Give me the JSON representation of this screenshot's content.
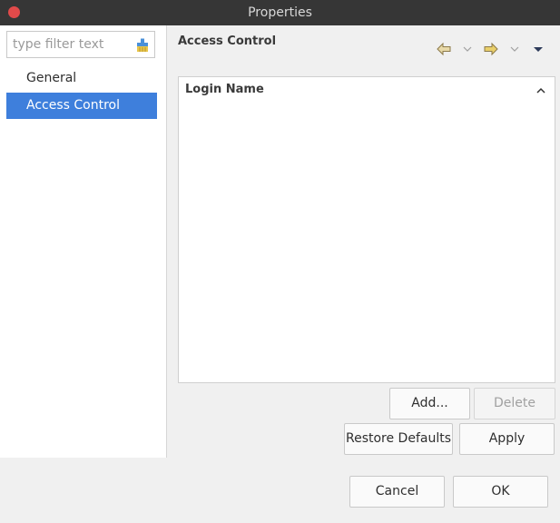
{
  "window": {
    "title": "Properties"
  },
  "filter": {
    "placeholder": "type filter text"
  },
  "nav": {
    "items": [
      {
        "label": "General"
      },
      {
        "label": "Access Control"
      }
    ]
  },
  "page": {
    "title": "Access Control",
    "table": {
      "column": "Login Name",
      "rows": []
    }
  },
  "buttons": {
    "add": "Add...",
    "delete": "Delete",
    "restore_defaults": "Restore Defaults",
    "apply": "Apply",
    "cancel": "Cancel",
    "ok": "OK"
  },
  "colors": {
    "selection": "#3e7fdc",
    "titlebar": "#363636",
    "close": "#e14a4a"
  },
  "icons": [
    "close-icon",
    "clear-filter-icon",
    "back-arrow-icon",
    "forward-arrow-icon",
    "view-menu-icon",
    "sort-ascending-icon"
  ]
}
